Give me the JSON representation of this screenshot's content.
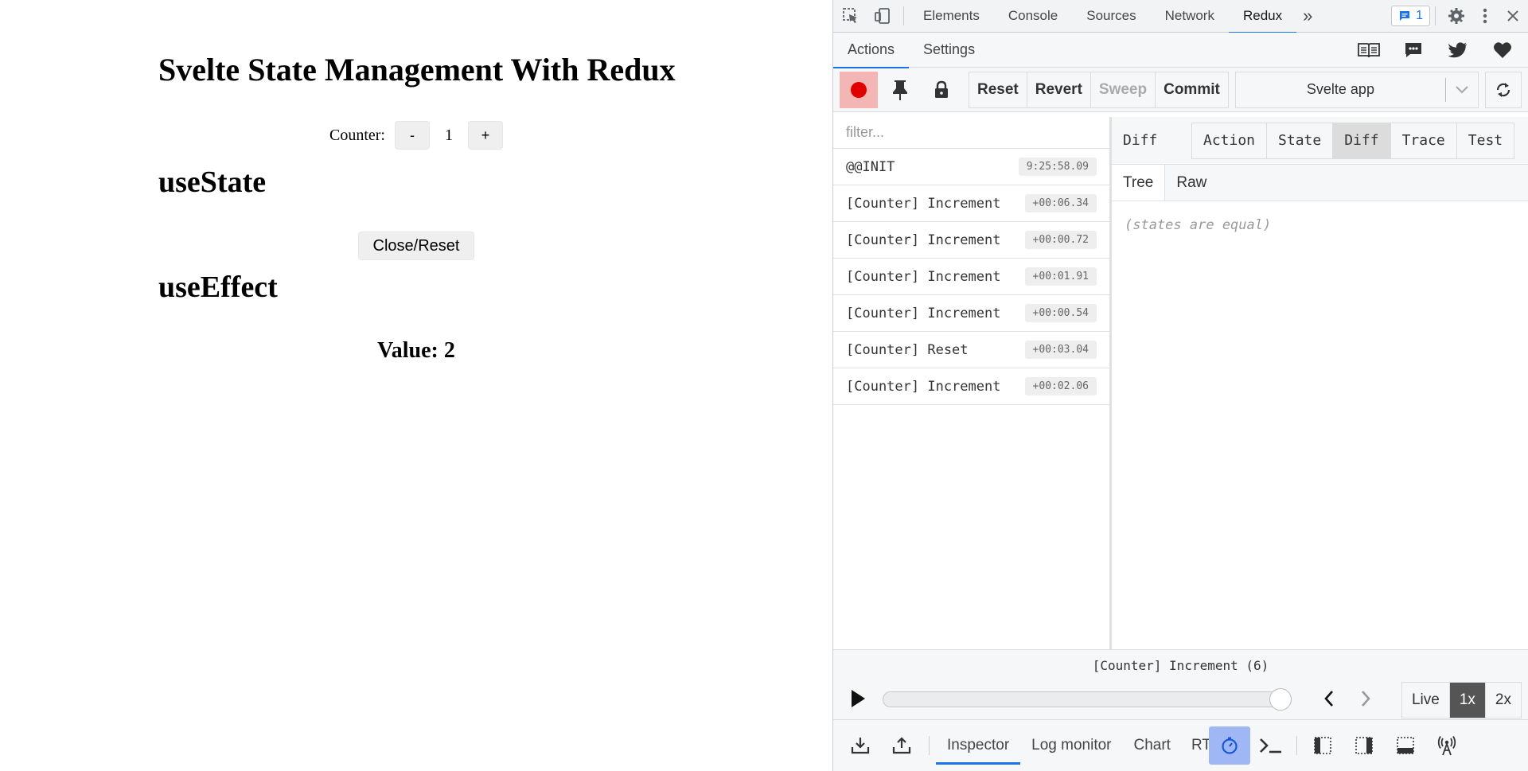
{
  "app": {
    "title": "Svelte State Management With Redux",
    "counter_label": "Counter:",
    "decrement_label": "-",
    "counter_value": "1",
    "increment_label": "+",
    "section_state": "useState",
    "reset_button": "Close/Reset",
    "section_effect": "useEffect",
    "value_text": "Value: 2"
  },
  "devtools": {
    "tabs": [
      "Elements",
      "Console",
      "Sources",
      "Network",
      "Redux"
    ],
    "active_tab": "Redux",
    "more_tabs": "»",
    "issues_count": "1",
    "redux_tabs": [
      "Actions",
      "Settings"
    ],
    "toolbar": {
      "reset": "Reset",
      "revert": "Revert",
      "sweep": "Sweep",
      "commit": "Commit",
      "instance": "Svelte app"
    },
    "filter_placeholder": "filter...",
    "actions": [
      {
        "name": "@@INIT",
        "time": "9:25:58.09"
      },
      {
        "name": "[Counter] Increment",
        "time": "+00:06.34"
      },
      {
        "name": "[Counter] Increment",
        "time": "+00:00.72"
      },
      {
        "name": "[Counter] Increment",
        "time": "+00:01.91"
      },
      {
        "name": "[Counter] Increment",
        "time": "+00:00.54"
      },
      {
        "name": "[Counter] Reset",
        "time": "+00:03.04"
      },
      {
        "name": "[Counter] Increment",
        "time": "+00:02.06"
      }
    ],
    "panel_title": "Diff",
    "panel_tabs": [
      "Action",
      "State",
      "Diff",
      "Trace",
      "Test"
    ],
    "panel_active": "Diff",
    "sub_tabs": [
      "Tree",
      "Raw"
    ],
    "states_equal": "(states are equal)",
    "slider_label": "[Counter] Increment (6)",
    "slider_progress": 1.0,
    "speeds": [
      "Live",
      "1x",
      "2x"
    ],
    "speed_active": "1x",
    "bottom_tabs": [
      "Inspector",
      "Log monitor",
      "Chart",
      "RT"
    ],
    "bottom_active": "Inspector",
    "colors": {
      "accent": "#1a73e8",
      "record": "#e00000",
      "record_bg": "#f4b5b5"
    }
  }
}
